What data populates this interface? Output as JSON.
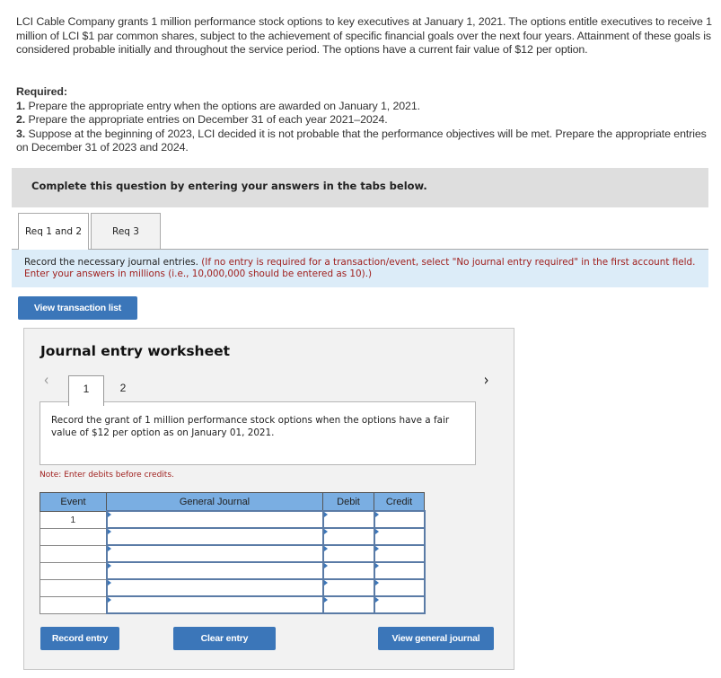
{
  "problem": {
    "intro": "LCI Cable Company grants 1 million performance stock options to key executives at January 1, 2021. The options entitle executives to receive 1 million of LCI $1 par common shares, subject to the achievement of specific financial goals over the next four years. Attainment of these goals is considered probable initially and throughout the service period. The options have a current fair value of $12 per option.",
    "required_title": "Required:",
    "requirements": [
      {
        "num": "1.",
        "text": " Prepare the appropriate entry when the options are awarded on January 1, 2021."
      },
      {
        "num": "2.",
        "text": " Prepare the appropriate entries on December 31 of each year 2021–2024."
      },
      {
        "num": "3.",
        "text": " Suppose at the beginning of 2023, LCI decided it is not probable that the performance objectives will be met. Prepare the appropriate entries on December 31 of 2023 and 2024."
      }
    ]
  },
  "complete_bar": "Complete this question by entering your answers in the tabs below.",
  "tabs": [
    {
      "label": "Req 1 and 2",
      "active": true
    },
    {
      "label": "Req 3",
      "active": false
    }
  ],
  "instruction": {
    "main": "Record the necessary journal entries. ",
    "note": "(If no entry is required for a transaction/event, select \"No journal entry required\" in the first account field. Enter your answers in millions (i.e., 10,000,000 should be entered as 10).)"
  },
  "buttons": {
    "view_transaction_list": "View transaction list",
    "record_entry": "Record entry",
    "clear_entry": "Clear entry",
    "view_general_journal": "View general journal"
  },
  "worksheet": {
    "title": "Journal entry worksheet",
    "prev_icon": "‹",
    "next_icon": "›",
    "entry_tabs": [
      "1",
      "2"
    ],
    "active_entry": "1",
    "description": "Record the grant of 1 million performance stock options when the options have a fair value of $12 per option as on January 01, 2021.",
    "note": "Note: Enter debits before credits.",
    "table": {
      "headers": [
        "Event",
        "General Journal",
        "Debit",
        "Credit"
      ],
      "rows": [
        {
          "event": "1",
          "account": "",
          "debit": "",
          "credit": ""
        },
        {
          "event": "",
          "account": "",
          "debit": "",
          "credit": ""
        },
        {
          "event": "",
          "account": "",
          "debit": "",
          "credit": ""
        },
        {
          "event": "",
          "account": "",
          "debit": "",
          "credit": ""
        },
        {
          "event": "",
          "account": "",
          "debit": "",
          "credit": ""
        },
        {
          "event": "",
          "account": "",
          "debit": "",
          "credit": ""
        }
      ]
    }
  }
}
